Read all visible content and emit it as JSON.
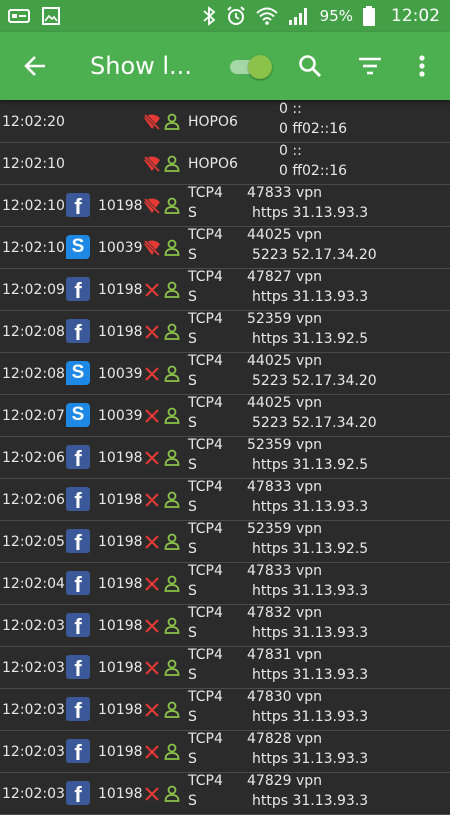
{
  "status_bar": {
    "battery": "95%",
    "time": "12:02"
  },
  "app_bar": {
    "title": "Show l..."
  },
  "rows": [
    {
      "time": "12:02:20",
      "app": "",
      "uid": "",
      "state": "blocked-wifi",
      "proto": "HOPO6",
      "sport": "",
      "src": "0 ::",
      "dst": "0 ff02::16"
    },
    {
      "time": "12:02:10",
      "app": "",
      "uid": "",
      "state": "blocked-wifi",
      "proto": "HOPO6",
      "sport": "",
      "src": "0 ::",
      "dst": "0 ff02::16"
    },
    {
      "time": "12:02:10",
      "app": "facebook",
      "uid": "10198",
      "state": "blocked-wifi",
      "proto": "TCP4",
      "flag": "S",
      "sport": "47833 vpn",
      "dst": "https 31.13.93.3"
    },
    {
      "time": "12:02:10",
      "app": "skype",
      "uid": "10039",
      "state": "blocked-wifi",
      "proto": "TCP4",
      "flag": "S",
      "sport": "44025 vpn",
      "dst": "5223 52.17.34.20"
    },
    {
      "time": "12:02:09",
      "app": "facebook",
      "uid": "10198",
      "state": "blocked",
      "proto": "TCP4",
      "flag": "S",
      "sport": "47827 vpn",
      "dst": "https 31.13.93.3"
    },
    {
      "time": "12:02:08",
      "app": "facebook",
      "uid": "10198",
      "state": "blocked",
      "proto": "TCP4",
      "flag": "S",
      "sport": "52359 vpn",
      "dst": "https 31.13.92.5"
    },
    {
      "time": "12:02:08",
      "app": "skype",
      "uid": "10039",
      "state": "blocked",
      "proto": "TCP4",
      "flag": "S",
      "sport": "44025 vpn",
      "dst": "5223 52.17.34.20"
    },
    {
      "time": "12:02:07",
      "app": "skype",
      "uid": "10039",
      "state": "blocked",
      "proto": "TCP4",
      "flag": "S",
      "sport": "44025 vpn",
      "dst": "5223 52.17.34.20"
    },
    {
      "time": "12:02:06",
      "app": "facebook",
      "uid": "10198",
      "state": "blocked",
      "proto": "TCP4",
      "flag": "S",
      "sport": "52359 vpn",
      "dst": "https 31.13.92.5"
    },
    {
      "time": "12:02:06",
      "app": "facebook",
      "uid": "10198",
      "state": "blocked",
      "proto": "TCP4",
      "flag": "S",
      "sport": "47833 vpn",
      "dst": "https 31.13.93.3"
    },
    {
      "time": "12:02:05",
      "app": "facebook",
      "uid": "10198",
      "state": "blocked",
      "proto": "TCP4",
      "flag": "S",
      "sport": "52359 vpn",
      "dst": "https 31.13.92.5"
    },
    {
      "time": "12:02:04",
      "app": "facebook",
      "uid": "10198",
      "state": "blocked",
      "proto": "TCP4",
      "flag": "S",
      "sport": "47833 vpn",
      "dst": "https 31.13.93.3"
    },
    {
      "time": "12:02:03",
      "app": "facebook",
      "uid": "10198",
      "state": "blocked",
      "proto": "TCP4",
      "flag": "S",
      "sport": "47832 vpn",
      "dst": "https 31.13.93.3"
    },
    {
      "time": "12:02:03",
      "app": "facebook",
      "uid": "10198",
      "state": "blocked",
      "proto": "TCP4",
      "flag": "S",
      "sport": "47831 vpn",
      "dst": "https 31.13.93.3"
    },
    {
      "time": "12:02:03",
      "app": "facebook",
      "uid": "10198",
      "state": "blocked",
      "proto": "TCP4",
      "flag": "S",
      "sport": "47830 vpn",
      "dst": "https 31.13.93.3"
    },
    {
      "time": "12:02:03",
      "app": "facebook",
      "uid": "10198",
      "state": "blocked",
      "proto": "TCP4",
      "flag": "S",
      "sport": "47828 vpn",
      "dst": "https 31.13.93.3"
    },
    {
      "time": "12:02:03",
      "app": "facebook",
      "uid": "10198",
      "state": "blocked",
      "proto": "TCP4",
      "flag": "S",
      "sport": "47829 vpn",
      "dst": "https 31.13.93.3"
    }
  ],
  "colors": {
    "appbar": "#4caf50",
    "statusbar": "#43a047",
    "blocked": "#e53935",
    "user": "#8bc34a",
    "background": "#2b2b2b"
  },
  "icons": {
    "back": "arrow-back-icon",
    "search": "search-icon",
    "filter": "filter-icon",
    "more": "more-vert-icon"
  }
}
